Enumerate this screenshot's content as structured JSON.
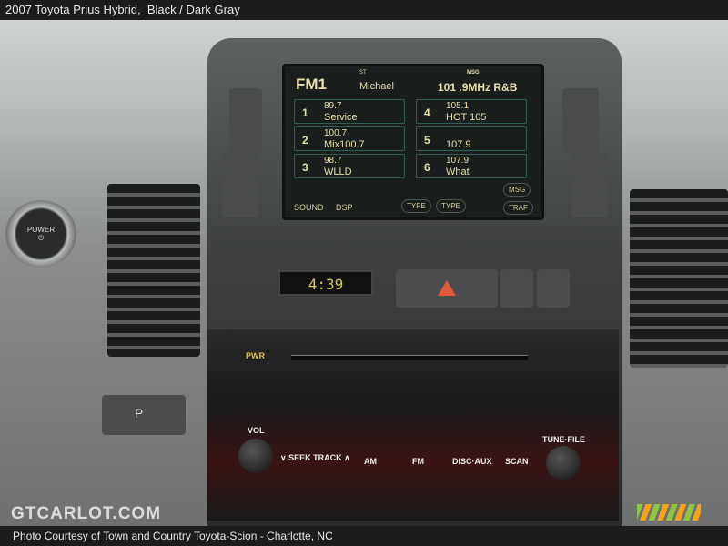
{
  "caption": {
    "title": "2007 Toyota Prius Hybrid,",
    "color": "Black / Dark Gray",
    "credit": "Photo Courtesy of Town and Country Toyota-Scion - Charlotte, NC"
  },
  "watermark": "GTCARLOT.COM",
  "screen": {
    "band": "FM1",
    "station_label": "ST",
    "station": "Michael",
    "msg_label": "MSG",
    "frequency": "101 .9MHz R&B",
    "presets": [
      {
        "n": "1",
        "freq": "89.7",
        "label": "Service"
      },
      {
        "n": "2",
        "freq": "100.7",
        "label": "Mix100.7"
      },
      {
        "n": "3",
        "freq": "98.7",
        "label": "WLLD"
      },
      {
        "n": "4",
        "freq": "105.1",
        "label": "HOT 105"
      },
      {
        "n": "5",
        "freq": "",
        "label": "107.9"
      },
      {
        "n": "6",
        "freq": "107.9",
        "label": "What"
      }
    ],
    "sound": "SOUND",
    "dsp": "DSP",
    "type_prev": "TYPE",
    "type_next": "TYPE",
    "msg": "MSG",
    "traf": "TRAF"
  },
  "clock": "4:39",
  "power_button": "POWER",
  "radio": {
    "pwr": "PWR",
    "vol": "VOL",
    "seek": "∨ SEEK TRACK ∧",
    "am": "AM",
    "fm": "FM",
    "disc": "DISC·AUX",
    "scan": "SCAN",
    "tune": "TUNE·FILE",
    "park": "P"
  }
}
